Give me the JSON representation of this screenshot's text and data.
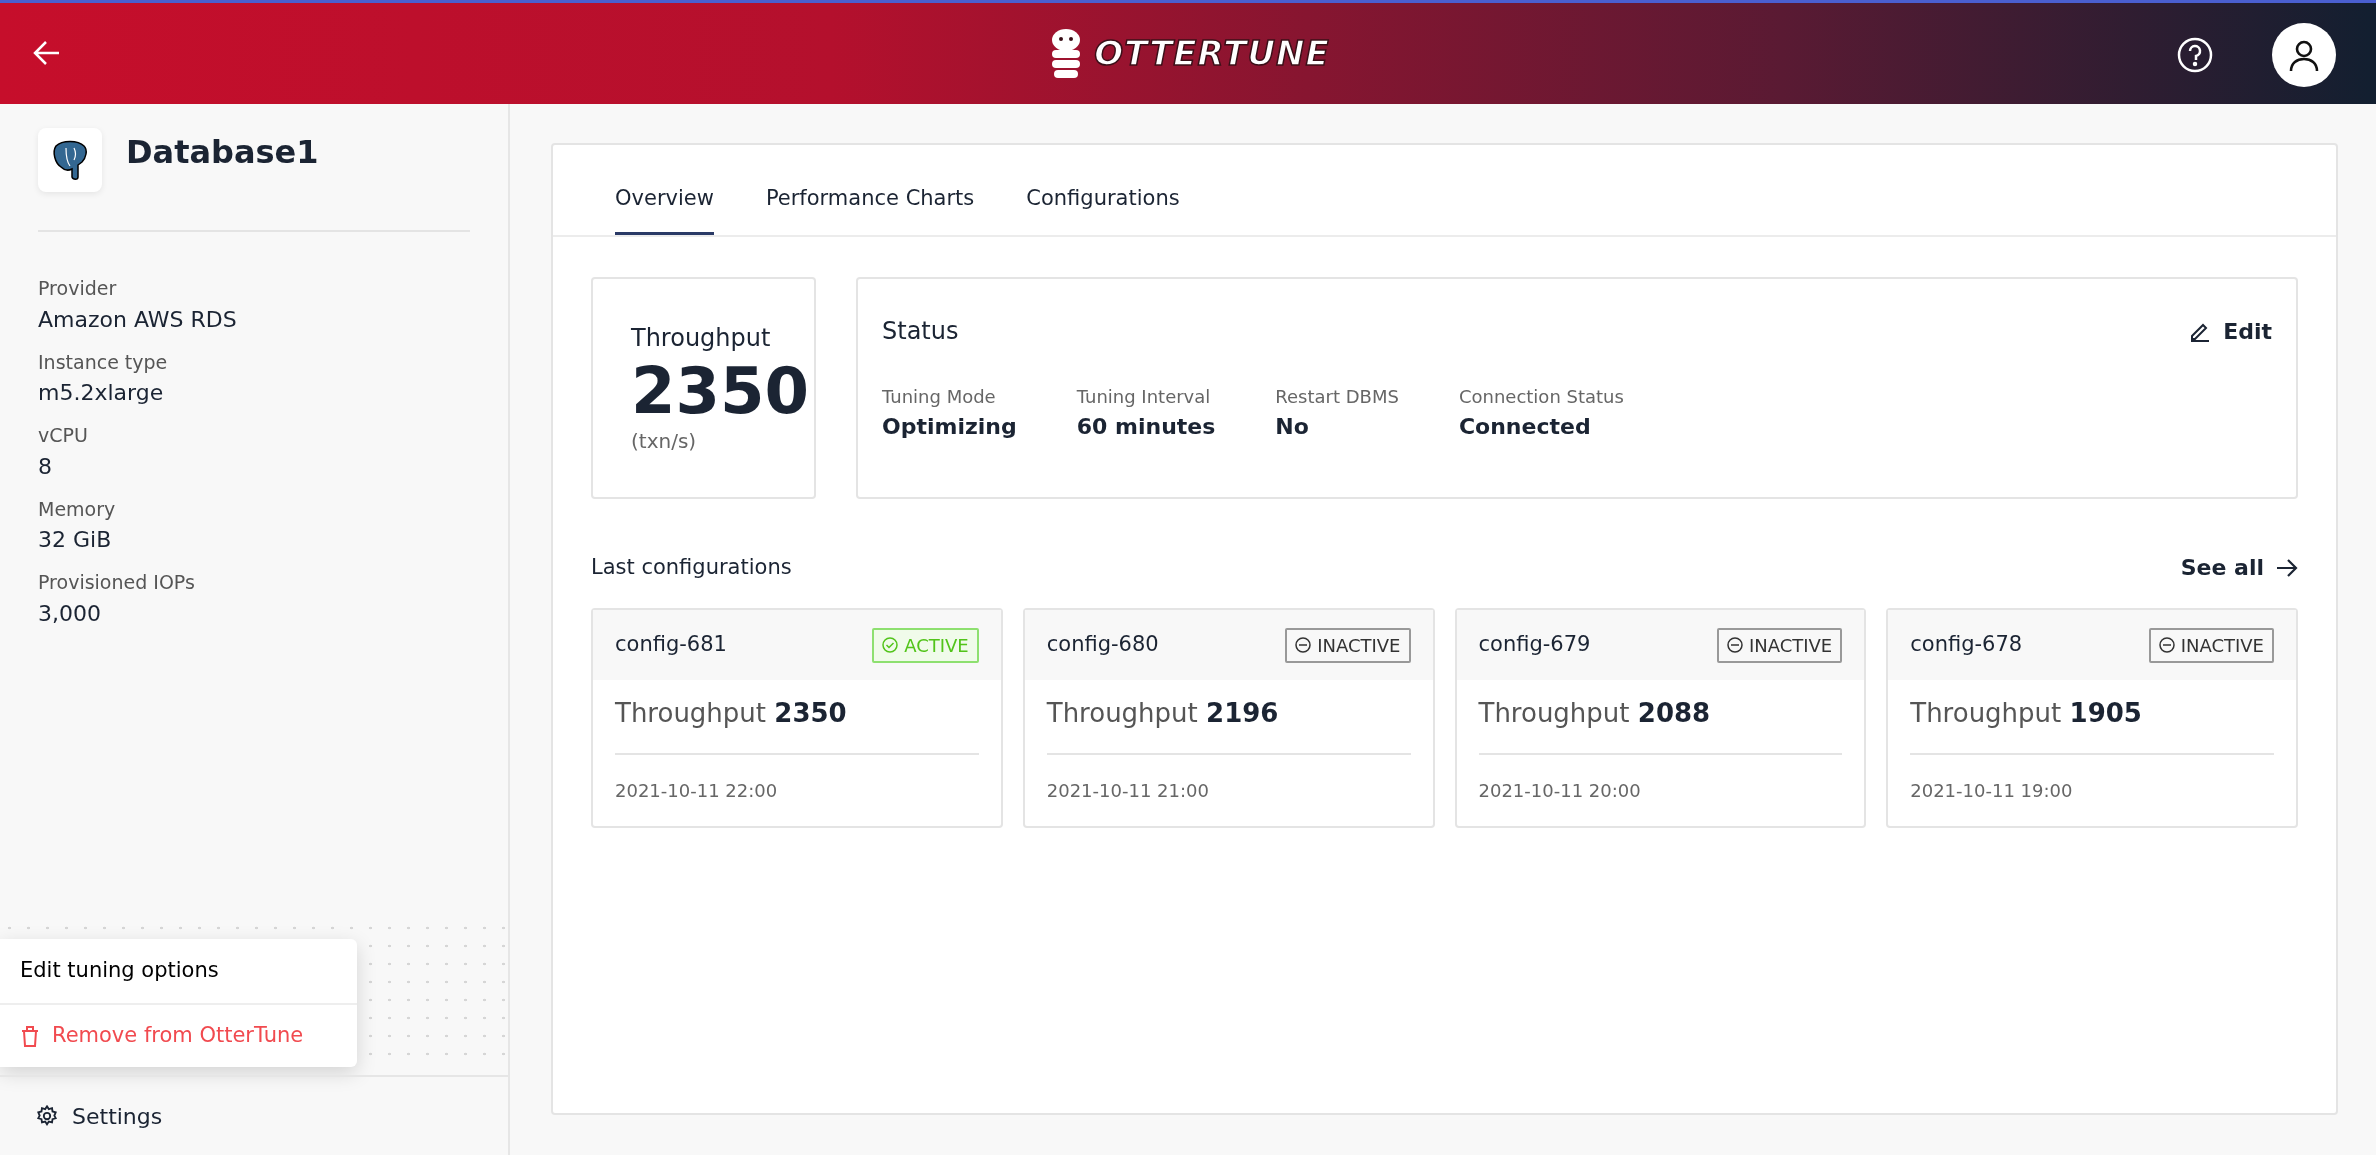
{
  "header": {
    "logo_text": "OTTERTUNE"
  },
  "sidebar": {
    "database_name": "Database1",
    "properties": [
      {
        "label": "Provider",
        "value": "Amazon AWS RDS"
      },
      {
        "label": "Instance type",
        "value": "m5.2xlarge"
      },
      {
        "label": "vCPU",
        "value": "8"
      },
      {
        "label": "Memory",
        "value": "32 GiB"
      },
      {
        "label": "Provisioned IOPs",
        "value": "3,000"
      }
    ],
    "menu": [
      {
        "label": "Edit tuning options",
        "kind": "plain"
      },
      {
        "label": "Remove from OtterTune",
        "kind": "danger"
      }
    ],
    "settings": "Settings"
  },
  "tabs": [
    {
      "label": "Overview",
      "selected": true
    },
    {
      "label": "Performance Charts",
      "selected": false
    },
    {
      "label": "Configurations",
      "selected": false
    }
  ],
  "throughput": {
    "title": "Throughput",
    "value": "2350",
    "unit": "(txn/s)"
  },
  "status": {
    "title": "Status",
    "edit": "Edit",
    "fields": [
      {
        "label": "Tuning Mode",
        "value": "Optimizing"
      },
      {
        "label": "Tuning Interval",
        "value": "60 minutes"
      },
      {
        "label": "Restart DBMS",
        "value": "No"
      },
      {
        "label": "Connection Status",
        "value": "Connected"
      }
    ]
  },
  "last_configurations": {
    "title": "Last configurations",
    "see_all": "See all",
    "items": [
      {
        "name": "config-681",
        "active": true,
        "badge": "ACTIVE",
        "throughput": "Throughput **2350**",
        "time": "2021-10-11 22:00"
      },
      {
        "name": "config-680",
        "active": false,
        "badge": "INACTIVE",
        "throughput": "Throughput **2196**",
        "time": "2021-10-11 21:00"
      },
      {
        "name": "config-679",
        "active": false,
        "badge": "INACTIVE",
        "throughput": "Throughput **2088**",
        "time": "2021-10-11 20:00"
      },
      {
        "name": "config-678",
        "active": false,
        "badge": "INACTIVE",
        "throughput": "Throughput **1905**",
        "time": "2021-10-11 19:00"
      }
    ]
  }
}
